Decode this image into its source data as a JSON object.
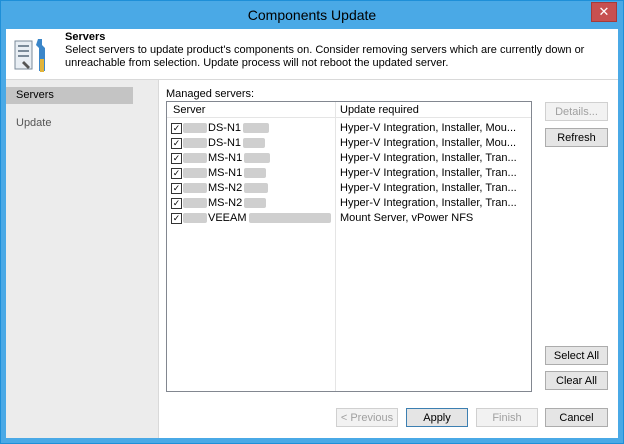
{
  "window": {
    "title": "Components Update",
    "close_glyph": "✕"
  },
  "header": {
    "title": "Servers",
    "description": "Select servers to update product's components on. Consider removing servers which are currently down or unreachable from selection. Update process will not reboot the updated server.",
    "icon": "tools-icon"
  },
  "sidebar": {
    "items": [
      {
        "label": "Servers",
        "active": true
      },
      {
        "label": "Update",
        "active": false
      }
    ]
  },
  "main": {
    "managed_label": "Managed servers:",
    "columns": {
      "server": "Server",
      "update": "Update required"
    },
    "rows": [
      {
        "checked": true,
        "server_visible": "DS-N1",
        "update": "Hyper-V Integration, Installer, Mou..."
      },
      {
        "checked": true,
        "server_visible": "DS-N1",
        "update": "Hyper-V Integration, Installer, Mou..."
      },
      {
        "checked": true,
        "server_visible": "MS-N1",
        "update": "Hyper-V Integration, Installer, Tran..."
      },
      {
        "checked": true,
        "server_visible": "MS-N1",
        "update": "Hyper-V Integration, Installer, Tran..."
      },
      {
        "checked": true,
        "server_visible": "MS-N2",
        "update": "Hyper-V Integration, Installer, Tran..."
      },
      {
        "checked": true,
        "server_visible": "MS-N2",
        "update": "Hyper-V Integration, Installer, Tran..."
      },
      {
        "checked": true,
        "server_visible": "VEEAM",
        "update": "Mount Server, vPower NFS"
      }
    ]
  },
  "buttons": {
    "details": "Details...",
    "refresh": "Refresh",
    "select_all": "Select All",
    "clear_all": "Clear All",
    "previous": "< Previous",
    "apply": "Apply",
    "finish": "Finish",
    "cancel": "Cancel"
  },
  "colors": {
    "titlebar": "#4aa9e6",
    "sidebar": "#ececec",
    "active_nav": "#c4c4c4"
  }
}
